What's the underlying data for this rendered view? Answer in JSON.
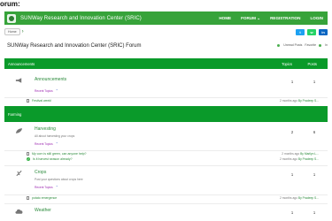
{
  "page_label": "orum:",
  "header": {
    "title": "SUNWay Research and Innovation Center (SRIC)",
    "nav": [
      "HOME",
      "FORUM ⌄",
      "REGISTRATION",
      "LOGIN"
    ]
  },
  "breadcrumb": {
    "home": "Home"
  },
  "share": {
    "twitter": "t",
    "whatsapp": "w",
    "linkedin": "in"
  },
  "forum_title": "SUNWay Research and Innovation Center (SRIC) Forum",
  "toplinks": {
    "unread": "Unread Posts",
    "favorites": "Favorite",
    "extra": "In"
  },
  "columns": {
    "topics": "Topics",
    "posts": "Posts"
  },
  "announcements": {
    "header": "Announcements",
    "forum": {
      "name": "Announcements",
      "recent": "Recent Topics",
      "topics": "1",
      "posts": "1"
    },
    "topics": [
      {
        "title": "Festival week!",
        "time": "2 months ago",
        "by": "By Pradeep S..."
      }
    ]
  },
  "farming": {
    "header": "Farming",
    "harvesting": {
      "name": "Harvesting",
      "desc": "All about harvesting your crops",
      "recent": "Recent Topics",
      "topics": "2",
      "posts": "6",
      "topic_list": [
        {
          "title": "My corn is still green, can anyone help?",
          "time": "2 months ago",
          "by": "By Marilyn L..."
        },
        {
          "title": "Is it harvest season already?",
          "time": "2 months ago",
          "by": "By Pradeep S..."
        }
      ]
    },
    "crops": {
      "name": "Crops",
      "desc": "Post your questions about crops here",
      "recent": "Recent Topics",
      "topics": "1",
      "posts": "1",
      "topic_list": [
        {
          "title": "potato emergence",
          "time": "2 months ago",
          "by": "By Pradeep S..."
        }
      ]
    },
    "weather": {
      "name": "Weather",
      "topics": "1",
      "posts": "1"
    }
  }
}
